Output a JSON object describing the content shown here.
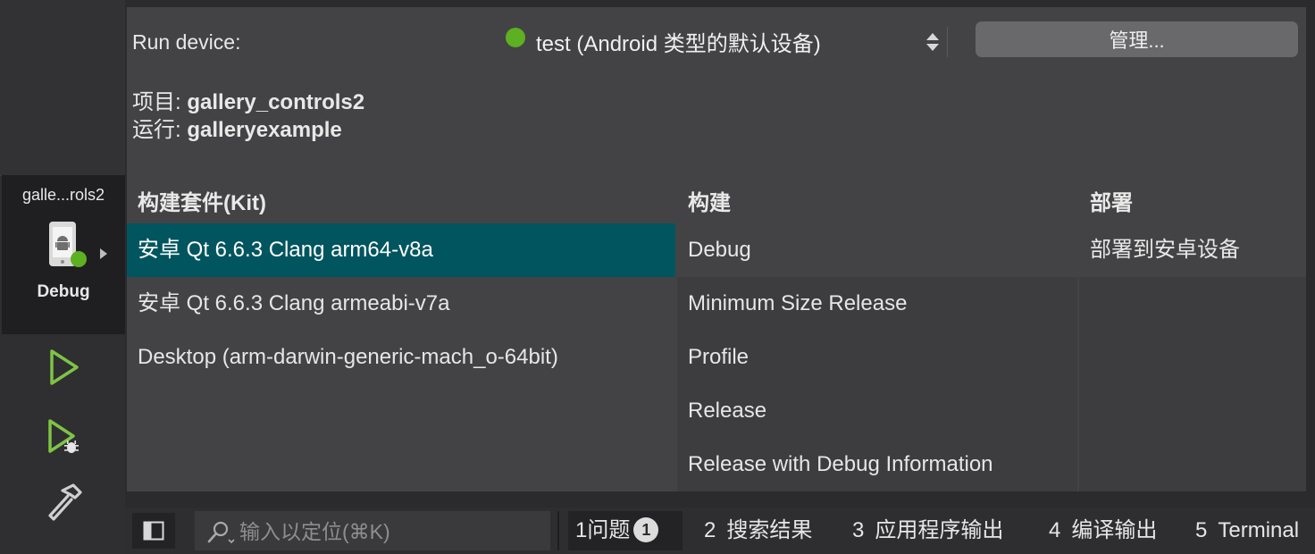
{
  "kit_selector": {
    "project_short": "galle...rols2",
    "config": "Debug"
  },
  "popup": {
    "run_device_label": "Run device:",
    "device": "test (Android 类型的默认设备)",
    "manage_button": "管理...",
    "project_label": "项目: ",
    "project_name": "gallery_controls2",
    "run_label": "运行: ",
    "run_name": "galleryexample",
    "headers": {
      "kit": "构建套件(Kit)",
      "build": "构建",
      "deploy": "部署"
    },
    "kits": [
      "安卓 Qt 6.6.3 Clang arm64-v8a",
      "安卓 Qt 6.6.3 Clang armeabi-v7a",
      "Desktop (arm-darwin-generic-mach_o-64bit)"
    ],
    "builds": [
      "Debug",
      "Minimum Size Release",
      "Profile",
      "Release",
      "Release with Debug Information"
    ],
    "deploys": [
      "部署到安卓设备"
    ]
  },
  "bottombar": {
    "locator_placeholder": "输入以定位(⌘K)",
    "tabs": [
      {
        "num": "1",
        "label": "问题",
        "badge": "1"
      },
      {
        "num": "2",
        "label": "搜索结果"
      },
      {
        "num": "3",
        "label": "应用程序输出"
      },
      {
        "num": "4",
        "label": "编译输出"
      },
      {
        "num": "5",
        "label": "Terminal"
      }
    ]
  },
  "colors": {
    "accent_selection": "#00555f",
    "status_green": "#5db021",
    "run_icon_green": "#7fc445"
  }
}
